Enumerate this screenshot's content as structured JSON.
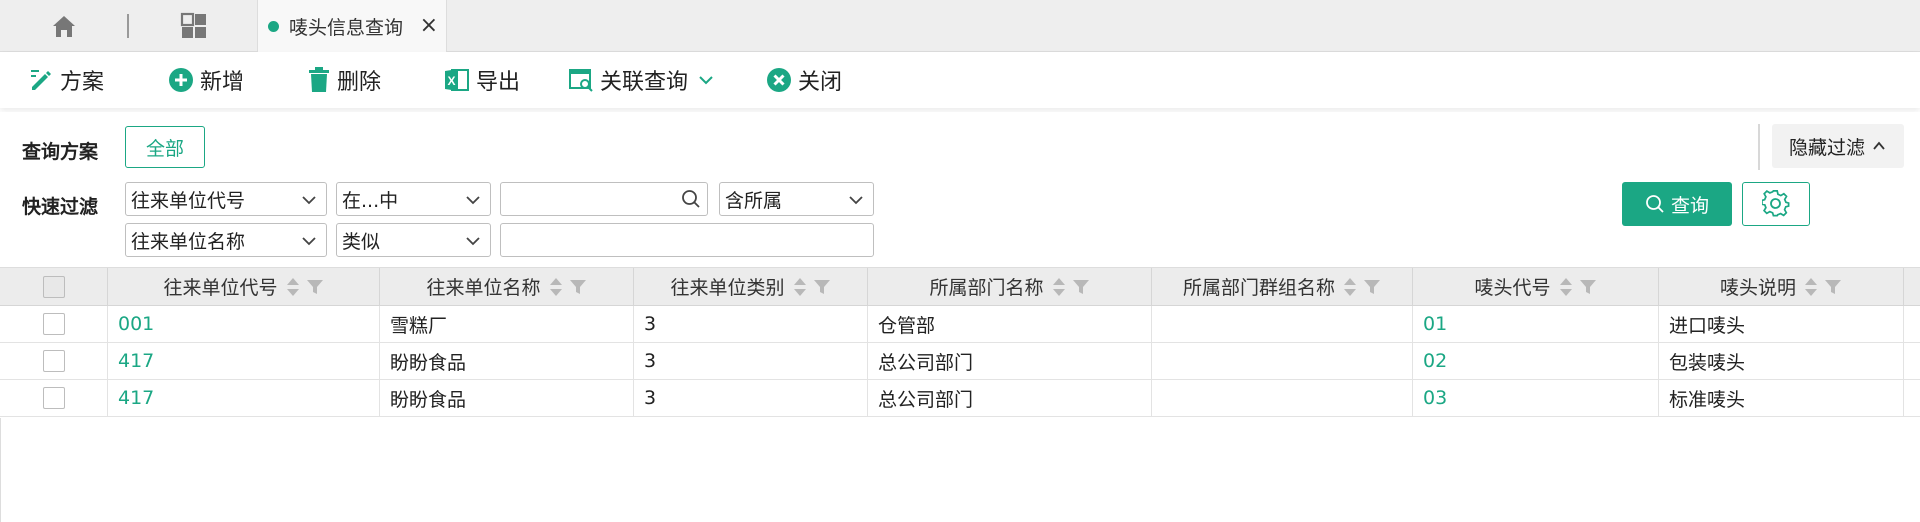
{
  "tabs": {
    "active_label": "唛头信息查询",
    "close": "×"
  },
  "toolbar": {
    "plan": "方案",
    "add": "新增",
    "delete": "删除",
    "export": "导出",
    "related_query": "关联查询",
    "close": "关闭"
  },
  "filter": {
    "plan_label": "查询方案",
    "all_button": "全部",
    "quick_label": "快速过滤",
    "row1": {
      "field": "往来单位代号",
      "op": "在...中",
      "value": "",
      "scope": "含所属"
    },
    "row2": {
      "field": "往来单位名称",
      "op": "类似",
      "value": ""
    },
    "hide_filter": "隐藏过滤",
    "query_button": "查询"
  },
  "colors": {
    "accent": "#1ba784",
    "header_bg": "#ececec"
  },
  "grid": {
    "columns": [
      "往来单位代号",
      "往来单位名称",
      "往来单位类别",
      "所属部门名称",
      "所属部门群组名称",
      "唛头代号",
      "唛头说明"
    ],
    "rows": [
      [
        "001",
        "雪糕厂",
        "3",
        "仓管部",
        "",
        "01",
        "进口唛头"
      ],
      [
        "417",
        "盼盼食品",
        "3",
        "总公司部门",
        "",
        "02",
        "包装唛头"
      ],
      [
        "417",
        "盼盼食品",
        "3",
        "总公司部门",
        "",
        "03",
        "标准唛头"
      ]
    ]
  }
}
